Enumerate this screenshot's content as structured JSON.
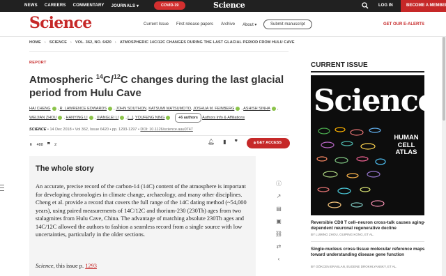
{
  "topbar": {
    "nav": [
      "NEWS",
      "CAREERS",
      "COMMENTARY",
      "JOURNALS ▾"
    ],
    "covid": "COVID-19",
    "logo": "Science",
    "login": "LOG IN",
    "member": "BECOME A MEMBER"
  },
  "header": {
    "brand": "Science",
    "nav": [
      "Current Issue",
      "First release papers",
      "Archive",
      "About ▾"
    ],
    "submit": "Submit manuscript",
    "alerts": "GET OUR E-ALERTS"
  },
  "breadcrumb": [
    "HOME",
    "SCIENCE",
    "VOL. 362, NO. 6420",
    "ATMOSPHERIC 14C/12C CHANGES DURING THE LAST GLACIAL PERIOD FROM HULU CAVE"
  ],
  "article": {
    "type": "REPORT",
    "title_a": "Atmospheric ",
    "title_sup1": "14",
    "title_b": "C/",
    "title_sup2": "12",
    "title_c": "C changes during the last glacial period from Hulu Cave",
    "authors": [
      "HAI CHENG",
      "R. LAWRENCE EDWARDS",
      "JOHN SOUTHON",
      "KATSUMI MATSUMOTO",
      "JOSHUA M. FEINBERG",
      "ASHISH SINHA",
      "WEIJIAN ZHOU",
      "HANYING LI",
      "XIANGLEI LI",
      "[...]",
      "YOUFENG NING"
    ],
    "more_authors": "+6 authors",
    "affiliations": "Authors Info & Affiliations",
    "journal": "SCIENCE",
    "date": "14 Dec 2018",
    "volume": "Vol 362, Issue 6420",
    "pages": "pp. 1293-1297",
    "doi": "DOI: 10.1126/science.aau0747",
    "views": "488",
    "citations": "2",
    "access": "GET ACCESS"
  },
  "story": {
    "heading": "The whole story",
    "body": "An accurate, precise record of the carbon-14 (14C) content of the atmosphere is important for developing chronologies in climate change, archaeology, and many other disciplines. Cheng et al. provide a record that covers the full range of the 14C dating method (~54,000 years), using paired measurements of 14C/12C and thorium-230 (230Th) ages from two stalagmites from Hulu Cave, China. The advantage of matching absolute 230Th ages and 14C/12C allowed the authors to fashion a seamless record from a single source with low uncertainties, particularly in the older sections.",
    "cite_a": "Science",
    "cite_b": ", this issue p. ",
    "cite_link": "1293"
  },
  "current_issue": {
    "heading": "CURRENT ISSUE",
    "cover_title": "Science",
    "cover_headline": "HUMAN CELL ATLAS",
    "articles": [
      {
        "title": "Reversible CD8 T cell–neuron cross-talk causes aging-dependent neuronal regenerative decline",
        "by": "BY LUMING ZHOU, GUIPING KONG, ET AL."
      },
      {
        "title": "Single-nucleus cross-tissue molecular reference maps toward understanding disease gene function",
        "by": "BY GÖKCEN ERASLAN, EUGENE DROKHLYANSKY, ET AL."
      }
    ]
  }
}
